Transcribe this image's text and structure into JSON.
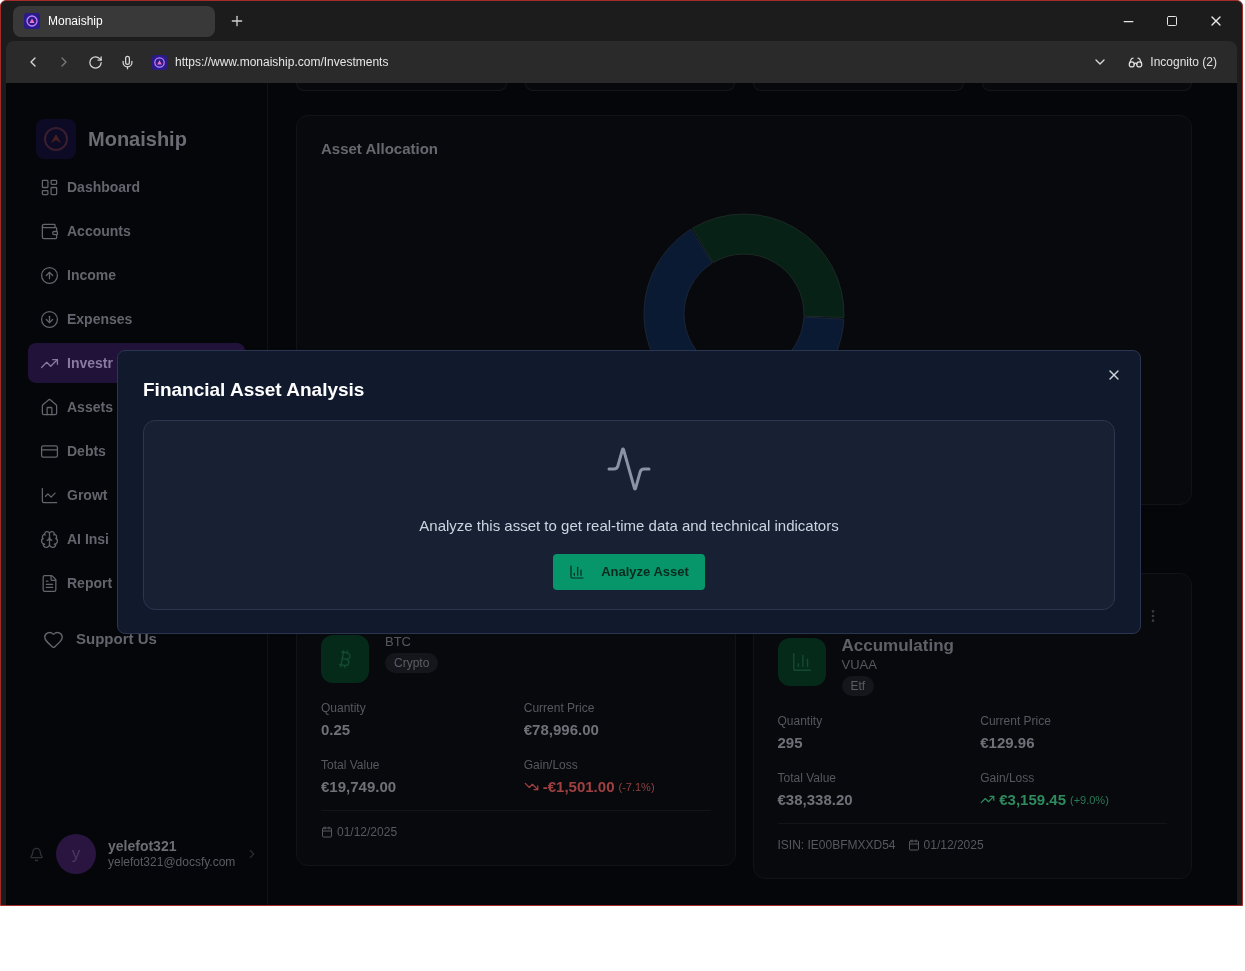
{
  "browser": {
    "tab_title": "Monaiship",
    "url": "https://www.monaiship.com/Investments",
    "profile": "Incognito (2)"
  },
  "sidebar": {
    "brand": "Monaiship",
    "items": [
      {
        "label": "Dashboard",
        "selected": false
      },
      {
        "label": "Accounts",
        "selected": false
      },
      {
        "label": "Income",
        "selected": false
      },
      {
        "label": "Expenses",
        "selected": false
      },
      {
        "label": "Investr",
        "selected": true
      },
      {
        "label": "Assets",
        "selected": false
      },
      {
        "label": "Debts",
        "selected": false
      },
      {
        "label": "Growt",
        "selected": false
      },
      {
        "label": "AI Insi",
        "selected": false
      },
      {
        "label": "Report",
        "selected": false
      }
    ],
    "support": "Support Us",
    "user": {
      "initial": "y",
      "name": "yelefot321",
      "email": "yelefot321@docsfy.com"
    }
  },
  "allocation": {
    "title": "Asset Allocation"
  },
  "holdings": [
    {
      "symbol": "BTC",
      "type": "Crypto",
      "quantity_label": "Quantity",
      "quantity": "0.25",
      "price_label": "Current Price",
      "price": "€78,996.00",
      "total_label": "Total Value",
      "total": "€19,749.00",
      "gain_label": "Gain/Loss",
      "gain": "-€1,501.00",
      "gain_pct": "(-7.1%)",
      "kind": "loss",
      "date": "01/12/2025"
    },
    {
      "name": "Accumulating",
      "symbol": "VUAA",
      "type": "Etf",
      "quantity_label": "Quantity",
      "quantity": "295",
      "price_label": "Current Price",
      "price": "€129.96",
      "total_label": "Total Value",
      "total": "€38,338.20",
      "gain_label": "Gain/Loss",
      "gain": "€3,159.45",
      "gain_pct": "(+9.0%)",
      "kind": "gain",
      "isin": "ISIN: IE00BFMXXD54",
      "date": "01/12/2025"
    }
  ],
  "modal": {
    "title": "Financial Asset Analysis",
    "message": "Analyze this asset to get real-time data and technical indicators",
    "button": "Analyze Asset"
  }
}
